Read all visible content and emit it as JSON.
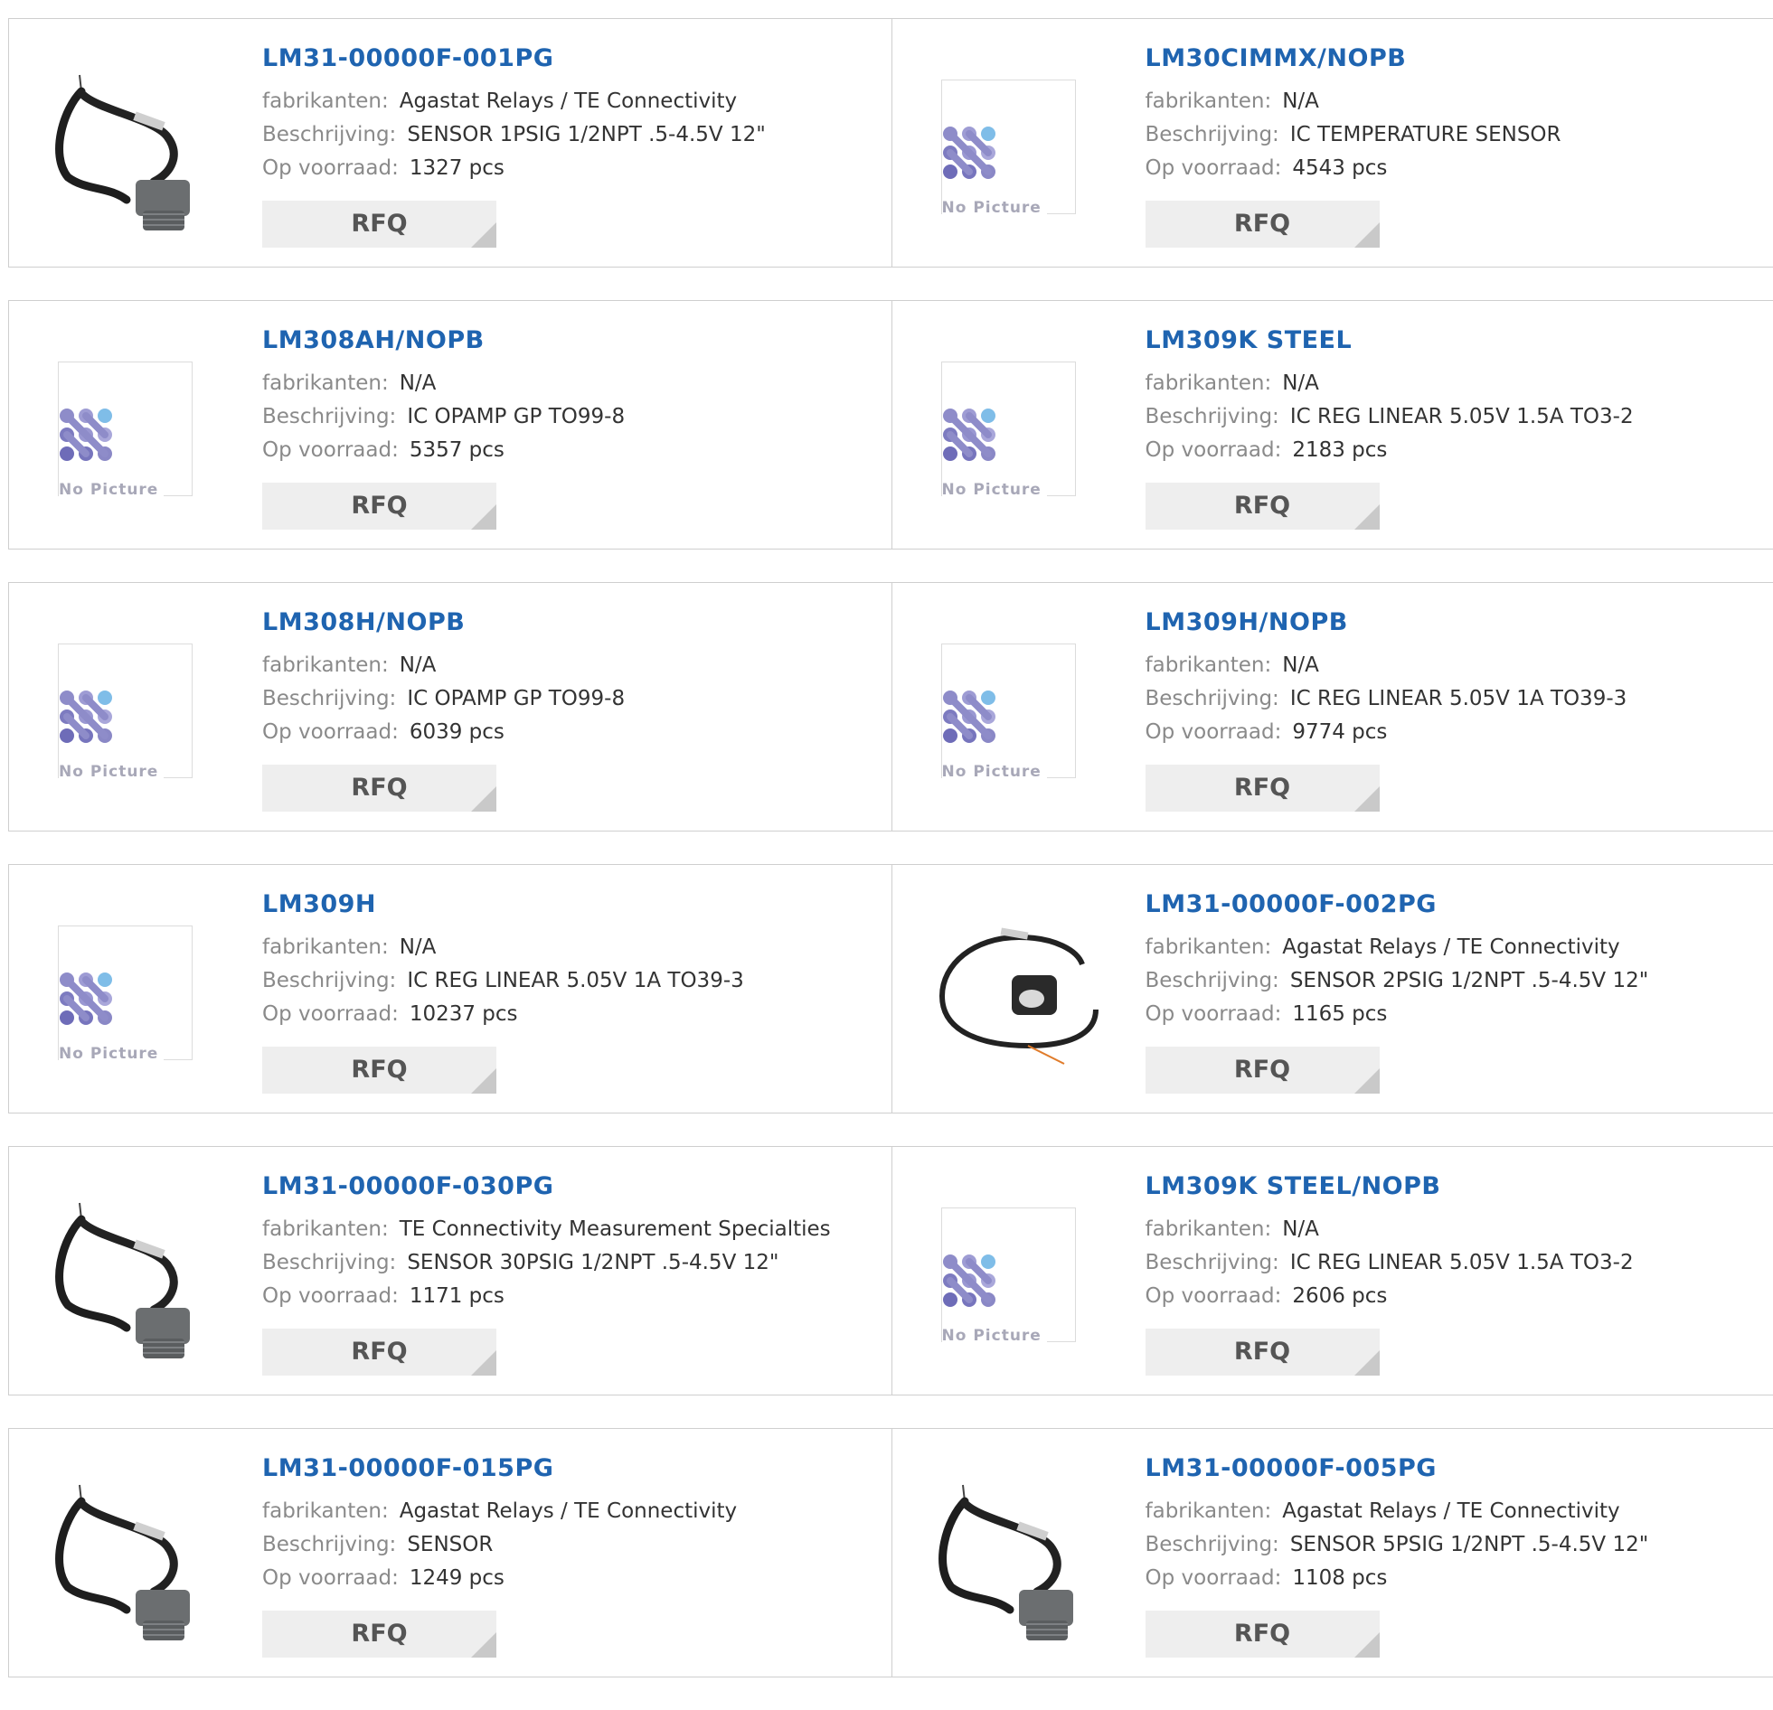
{
  "labels": {
    "manufacturer": "fabrikanten:",
    "description": "Beschrijving:",
    "stock": "Op voorraad:",
    "rfq": "RFQ",
    "no_picture": "No Picture"
  },
  "products": [
    {
      "part": "LM31-00000F-001PG",
      "manufacturer": "Agastat Relays / TE Connectivity",
      "description": "SENSOR 1PSIG 1/2NPT .5-4.5V 12\"",
      "stock": "1327 pcs",
      "image": "sensor-threaded"
    },
    {
      "part": "LM30CIMMX/NOPB",
      "manufacturer": "N/A",
      "description": "IC TEMPERATURE SENSOR",
      "stock": "4543 pcs",
      "image": "no-picture"
    },
    {
      "part": "LM308AH/NOPB",
      "manufacturer": "N/A",
      "description": "IC OPAMP GP TO99-8",
      "stock": "5357 pcs",
      "image": "no-picture"
    },
    {
      "part": "LM309K STEEL",
      "manufacturer": "N/A",
      "description": "IC REG LINEAR 5.05V 1.5A TO3-2",
      "stock": "2183 pcs",
      "image": "no-picture"
    },
    {
      "part": "LM308H/NOPB",
      "manufacturer": "N/A",
      "description": "IC OPAMP GP TO99-8",
      "stock": "6039 pcs",
      "image": "no-picture"
    },
    {
      "part": "LM309H/NOPB",
      "manufacturer": "N/A",
      "description": "IC REG LINEAR 5.05V 1A TO39-3",
      "stock": "9774 pcs",
      "image": "no-picture"
    },
    {
      "part": "LM309H",
      "manufacturer": "N/A",
      "description": "IC REG LINEAR 5.05V 1A TO39-3",
      "stock": "10237 pcs",
      "image": "no-picture"
    },
    {
      "part": "LM31-00000F-002PG",
      "manufacturer": "Agastat Relays / TE Connectivity",
      "description": "SENSOR 2PSIG 1/2NPT .5-4.5V 12\"",
      "stock": "1165 pcs",
      "image": "sensor-loop"
    },
    {
      "part": "LM31-00000F-030PG",
      "manufacturer": "TE Connectivity Measurement Specialties",
      "description": "SENSOR 30PSIG 1/2NPT .5-4.5V 12\"",
      "stock": "1171 pcs",
      "image": "sensor-threaded"
    },
    {
      "part": "LM309K STEEL/NOPB",
      "manufacturer": "N/A",
      "description": "IC REG LINEAR 5.05V 1.5A TO3-2",
      "stock": "2606 pcs",
      "image": "no-picture"
    },
    {
      "part": "LM31-00000F-015PG",
      "manufacturer": "Agastat Relays / TE Connectivity",
      "description": "SENSOR",
      "stock": "1249 pcs",
      "image": "sensor-threaded"
    },
    {
      "part": "LM31-00000F-005PG",
      "manufacturer": "Agastat Relays / TE Connectivity",
      "description": "SENSOR 5PSIG 1/2NPT .5-4.5V 12\"",
      "stock": "1108 pcs",
      "image": "sensor-threaded"
    }
  ]
}
